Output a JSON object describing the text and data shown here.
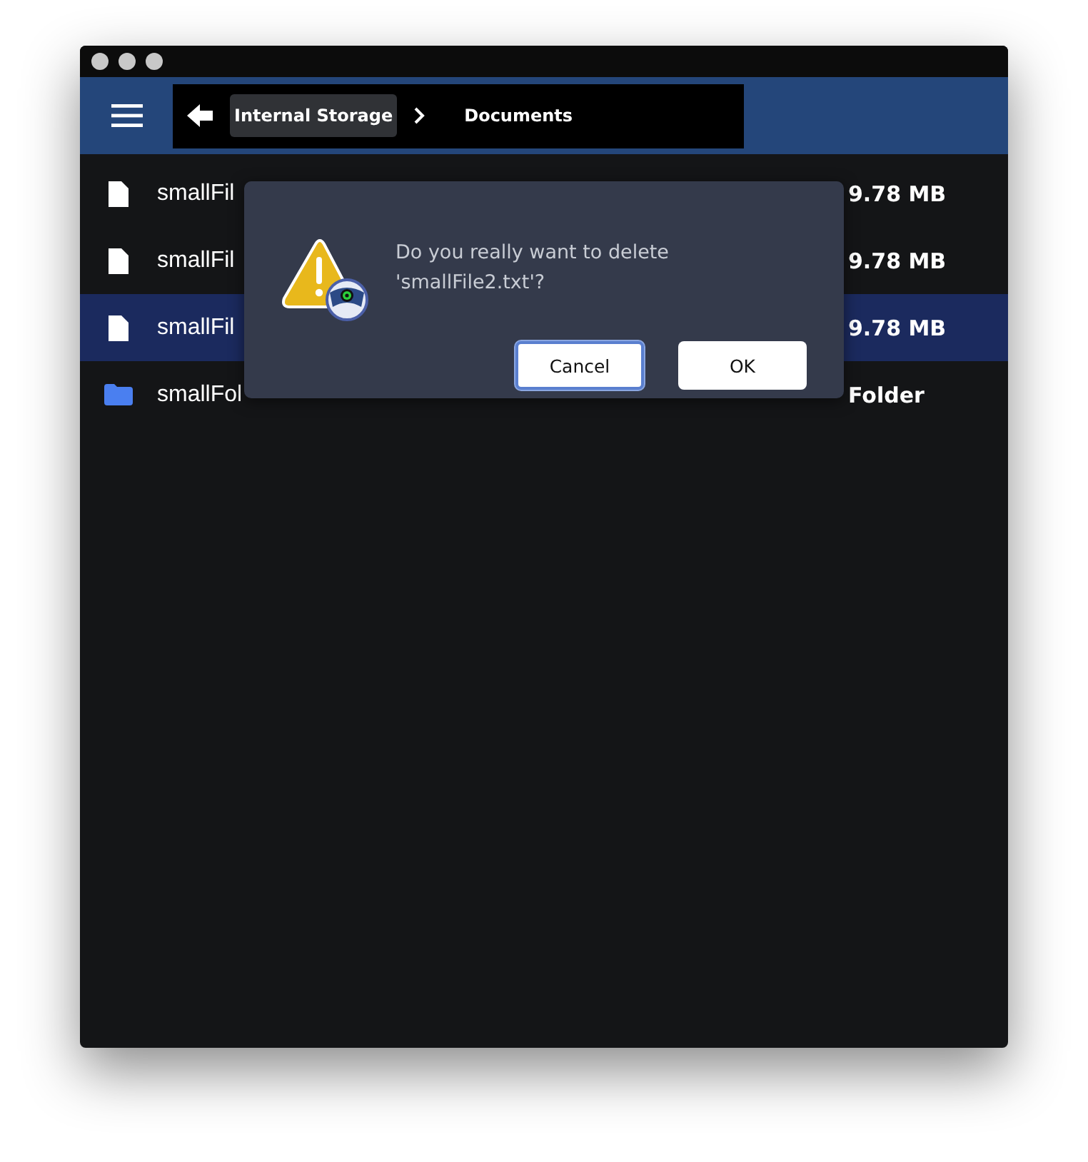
{
  "toolbar": {
    "breadcrumbs": [
      {
        "label": "Internal Storage",
        "selected": true
      },
      {
        "label": "Documents",
        "selected": false
      }
    ]
  },
  "files": [
    {
      "kind": "file",
      "name": "smallFil",
      "size": "9.78 MB",
      "selected": false
    },
    {
      "kind": "file",
      "name": "smallFil",
      "size": "9.78 MB",
      "selected": false
    },
    {
      "kind": "file",
      "name": "smallFil",
      "size": "9.78 MB",
      "selected": true
    },
    {
      "kind": "folder",
      "name": "smallFol",
      "size": "Folder",
      "selected": false
    }
  ],
  "dialog": {
    "message": "Do you really want to delete 'smallFile2.txt'?",
    "buttons": [
      {
        "label": "Cancel",
        "focused": true
      },
      {
        "label": "OK",
        "focused": false
      }
    ]
  }
}
